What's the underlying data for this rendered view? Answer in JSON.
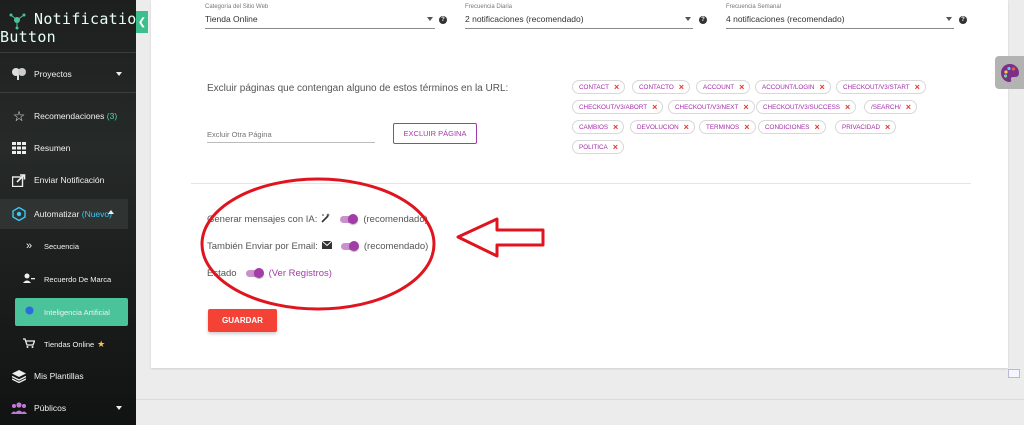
{
  "brand": {
    "line1": "Notification",
    "line2": "Button"
  },
  "sidebar": {
    "items": [
      {
        "label": "Proyectos",
        "icon": "brain-icon"
      },
      {
        "label": "Recomendaciones",
        "count": "(3)",
        "icon": "star-icon"
      },
      {
        "label": "Resumen",
        "icon": "grid-icon"
      },
      {
        "label": "Enviar Notificación",
        "icon": "share-icon"
      },
      {
        "label": "Automatizar",
        "badge": "(Nuevo)",
        "icon": "hexagon-icon"
      },
      {
        "label": "Mis Plantillas",
        "icon": "layers-icon"
      },
      {
        "label": "Públicos",
        "icon": "people-icon"
      }
    ],
    "subitems": [
      {
        "label": "Secuencia",
        "icon": "double-chevron-icon"
      },
      {
        "label": "Recuerdo De Marca",
        "icon": "user-key-icon"
      },
      {
        "label": "Inteligencia Artificial",
        "icon": "ai-dot-icon"
      },
      {
        "label": "Tiendas Online",
        "icon": "cart-icon",
        "star": "★"
      }
    ]
  },
  "settings": {
    "category": {
      "label": "Categoría del Sitio Web",
      "value": "Tienda Online"
    },
    "daily": {
      "label": "Frecuencia Diaria",
      "value": "2 notificaciones (recomendado)"
    },
    "weekly": {
      "label": "Frecuencia Semanal",
      "value": "4 notificaciones (recomendado)"
    },
    "help": "?"
  },
  "exclude": {
    "label": "Excluir páginas que contengan alguno de estos términos en la URL:",
    "placeholder": "Excluir Otra Página",
    "button": "EXCLUIR PÁGINA",
    "terms": [
      "CONTACT",
      "CONTACTO",
      "ACCOUNT",
      "ACCOUNT/LOGIN",
      "CHECKOUT/V3/START",
      "CHECKOUT/V3/ABORT",
      "CHECKOUT/V3/NEXT",
      "CHECKOUT/V3/SUCCESS",
      "/SEARCH/",
      "CAMBIOS",
      "DEVOLUCION",
      "TERMINOS",
      "CONDICIONES",
      "PRIVACIDAD",
      "POLITICA"
    ]
  },
  "options": {
    "ai": {
      "label": "Generar mensajes con IA:",
      "note": "(recomendado)",
      "icon": "magic-wand-icon"
    },
    "email": {
      "label": "También Enviar por Email:",
      "note": "(recomendado)",
      "icon": "envelope-icon"
    },
    "status": {
      "label": "Estado",
      "link": "(Ver Registros)"
    }
  },
  "save_label": "GUARDAR",
  "colors": {
    "accent": "#a33ba8",
    "primary_green": "#4ac29a",
    "danger": "#f44336",
    "annotation": "#e0141f"
  }
}
